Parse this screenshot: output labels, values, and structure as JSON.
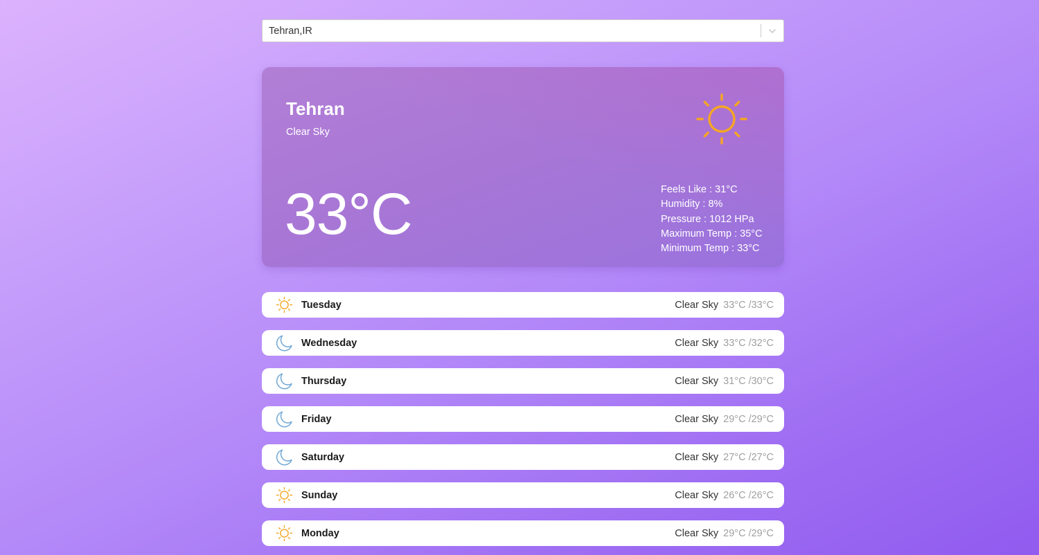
{
  "search": {
    "value": "Tehran,IR"
  },
  "current": {
    "city": "Tehran",
    "description": "Clear Sky",
    "temperature": "33°C",
    "icon": "sun-icon",
    "details": [
      "Feels Like : 31°C",
      "Humidity : 8%",
      "Pressure : 1012 HPa",
      "Maximum Temp : 35°C",
      "Minimum Temp : 33°C"
    ]
  },
  "forecast": [
    {
      "day": "Tuesday",
      "icon": "sun-icon",
      "condition": "Clear Sky",
      "temps": "33°C /33°C"
    },
    {
      "day": "Wednesday",
      "icon": "moon-icon",
      "condition": "Clear Sky",
      "temps": "33°C /32°C"
    },
    {
      "day": "Thursday",
      "icon": "moon-icon",
      "condition": "Clear Sky",
      "temps": "31°C /30°C"
    },
    {
      "day": "Friday",
      "icon": "moon-icon",
      "condition": "Clear Sky",
      "temps": "29°C /29°C"
    },
    {
      "day": "Saturday",
      "icon": "moon-icon",
      "condition": "Clear Sky",
      "temps": "27°C /27°C"
    },
    {
      "day": "Sunday",
      "icon": "sun-icon",
      "condition": "Clear Sky",
      "temps": "26°C /26°C"
    },
    {
      "day": "Monday",
      "icon": "sun-icon",
      "condition": "Clear Sky",
      "temps": "29°C /29°C"
    }
  ],
  "colors": {
    "sun": "#f5a623",
    "moon": "#6fa7d6"
  }
}
